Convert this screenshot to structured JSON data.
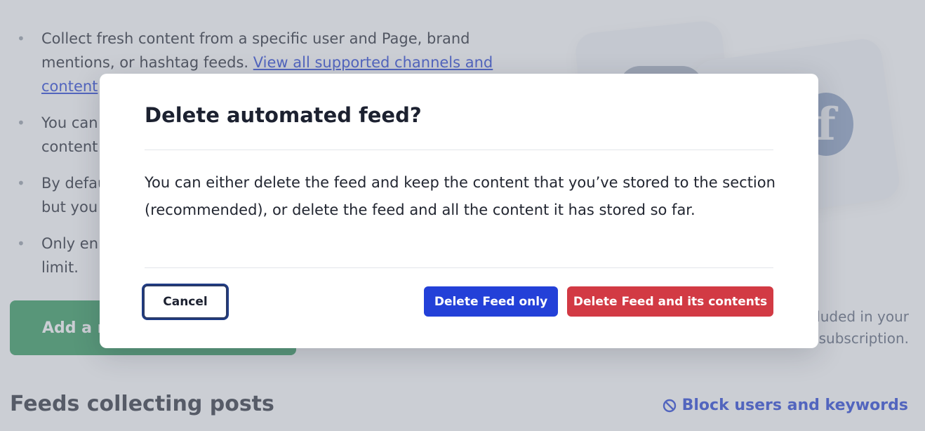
{
  "background": {
    "bullets": [
      {
        "text": "Collect fresh content from a specific user and Page, brand mentions, or hashtag feeds. ",
        "link": "View all supported channels and content"
      },
      {
        "text": "You can",
        "continued": "content"
      },
      {
        "text": "By defau",
        "continued": "but you"
      },
      {
        "text": "Only en",
        "continued": "limit."
      }
    ],
    "add_button_label": "Add a r",
    "side_note": "luded in your subscription.",
    "feeds_heading": "Feeds collecting posts",
    "block_link_label": "Block users and keywords",
    "fb_letter": "f"
  },
  "modal": {
    "title": "Delete automated feed?",
    "body": "You can either delete the feed and keep the content that you’ve stored to the section (recommended), or delete the feed and all the content it has stored so far.",
    "cancel_label": "Cancel",
    "delete_feed_only_label": "Delete Feed only",
    "delete_feed_contents_label": "Delete Feed and its contents"
  },
  "colors": {
    "primary": "#2340d8",
    "danger": "#d23a44",
    "success": "#2f9a59",
    "overlay": "rgba(140,146,160,0.45)"
  }
}
